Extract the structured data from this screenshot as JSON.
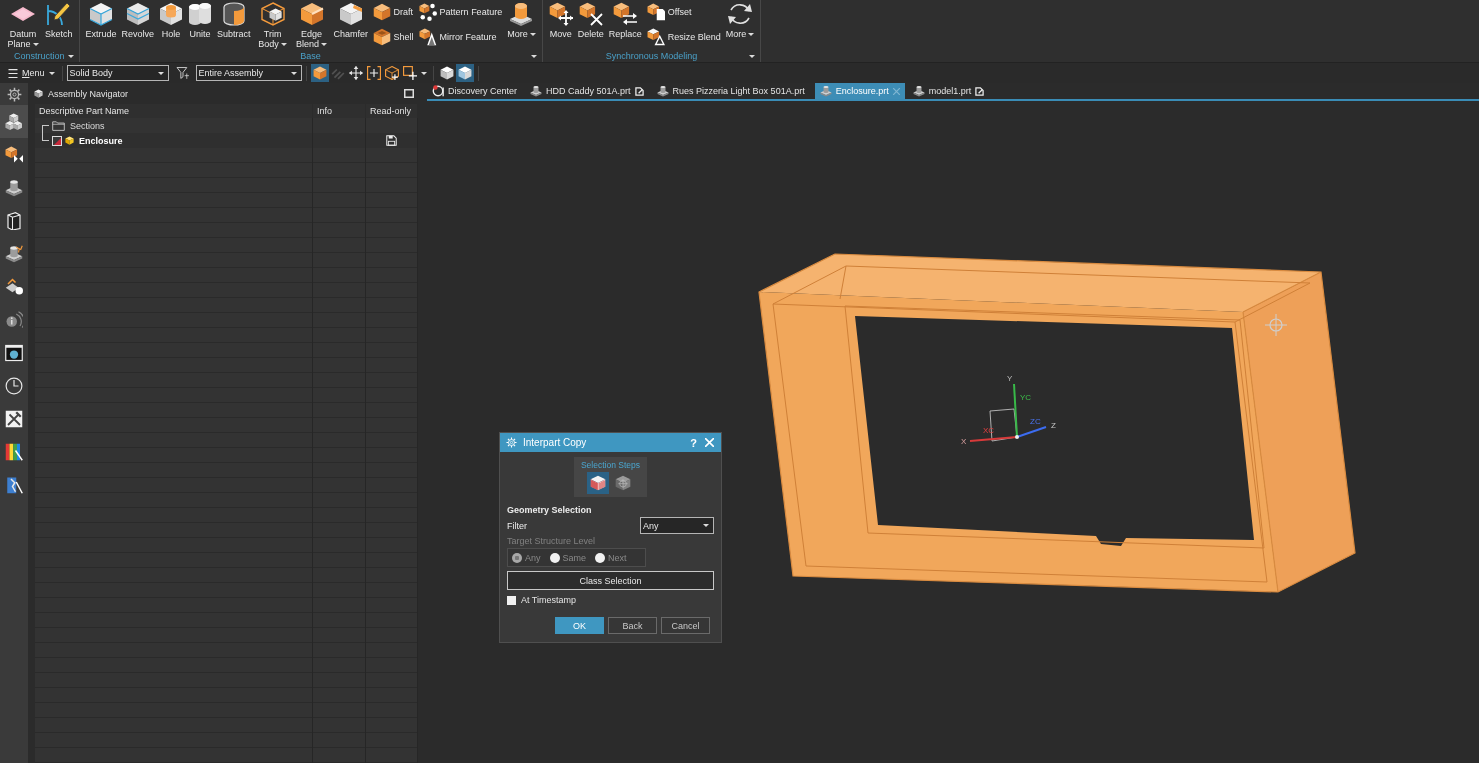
{
  "ribbon": {
    "groups": [
      {
        "label": "Construction",
        "launcher": true,
        "items": [
          {
            "kind": "large",
            "label": "Datum Plane",
            "dropdown": true
          },
          {
            "kind": "large",
            "label": "Sketch",
            "dropdown": false
          }
        ]
      },
      {
        "label": "Base",
        "launcher": true,
        "items": [
          {
            "kind": "large",
            "label": "Extrude",
            "dropdown": false
          },
          {
            "kind": "large",
            "label": "Revolve",
            "dropdown": false
          },
          {
            "kind": "large",
            "label": "Hole",
            "dropdown": false
          },
          {
            "kind": "large",
            "label": "Unite",
            "dropdown": false
          },
          {
            "kind": "large",
            "label": "Subtract",
            "dropdown": false
          },
          {
            "kind": "large",
            "label": "Trim Body",
            "dropdown": true
          },
          {
            "kind": "large",
            "label": "Edge Blend",
            "dropdown": true
          },
          {
            "kind": "large",
            "label": "Chamfer",
            "dropdown": false
          },
          {
            "kind": "stack",
            "items": [
              {
                "label": "Draft"
              },
              {
                "label": "Shell"
              }
            ]
          },
          {
            "kind": "stack",
            "items": [
              {
                "label": "Pattern Feature"
              },
              {
                "label": "Mirror Feature"
              }
            ]
          },
          {
            "kind": "large",
            "label": "More",
            "dropdown": true
          }
        ]
      },
      {
        "label": "Synchronous Modeling",
        "launcher": true,
        "items": [
          {
            "kind": "large",
            "label": "Move",
            "dropdown": false
          },
          {
            "kind": "large",
            "label": "Delete",
            "dropdown": false
          },
          {
            "kind": "large",
            "label": "Replace",
            "dropdown": false
          },
          {
            "kind": "stack",
            "items": [
              {
                "label": "Offset"
              },
              {
                "label": "Resize Blend"
              }
            ]
          },
          {
            "kind": "large",
            "label": "More",
            "dropdown": true
          }
        ]
      }
    ]
  },
  "toolbar": {
    "menu": "Menu",
    "type_filter": "Solid Body",
    "scope": "Entire Assembly",
    "tools": [
      {
        "on": true,
        "disabled": false
      },
      {
        "on": false,
        "disabled": true
      },
      {
        "on": false,
        "disabled": false
      },
      {
        "on": false,
        "disabled": false
      },
      {
        "on": false,
        "disabled": false
      },
      {
        "on": false,
        "disabled": false
      },
      {
        "on": false,
        "disabled": false
      },
      {
        "on": true,
        "disabled": false
      }
    ]
  },
  "sidebar": {
    "items": [
      {
        "selected": false
      },
      {
        "selected": true
      },
      {
        "selected": false
      },
      {
        "selected": false
      },
      {
        "selected": false
      },
      {
        "selected": false
      },
      {
        "selected": false
      },
      {
        "selected": false
      },
      {
        "selected": false
      },
      {
        "selected": false
      },
      {
        "selected": false
      },
      {
        "selected": false
      },
      {
        "selected": false
      }
    ]
  },
  "navigator": {
    "title": "Assembly Navigator",
    "columns": [
      "Descriptive Part Name",
      "Info",
      "Read-only"
    ],
    "rows": [
      {
        "kind": "folder",
        "name": "Sections"
      },
      {
        "kind": "part",
        "name": "Enclosure",
        "checked": true
      }
    ]
  },
  "tabs": [
    {
      "kind": "start",
      "label": "Discovery Center",
      "selected": false,
      "modified": false
    },
    {
      "kind": "part",
      "label": "HDD Caddy 501A.prt",
      "selected": false,
      "modified": true
    },
    {
      "kind": "part",
      "label": "Rues Pizzeria Light Box 501A.prt",
      "selected": false,
      "modified": false
    },
    {
      "kind": "part",
      "label": "Enclosure.prt",
      "selected": true,
      "modified": false
    },
    {
      "kind": "part",
      "label": "model1.prt",
      "selected": false,
      "modified": true
    }
  ],
  "viewport": {
    "triad": {
      "labels": [
        "X",
        "XC",
        "Y",
        "YC",
        "ZC",
        "Z"
      ]
    }
  },
  "dialog": {
    "title": "Interpart Copy",
    "help": "?",
    "steps_label": "Selection Steps",
    "steps": [
      {
        "selected": true
      },
      {
        "selected": false
      }
    ],
    "section": "Geometry Selection",
    "filter": {
      "label": "Filter",
      "value": "Any"
    },
    "structure": {
      "label": "Target Structure Level",
      "disabled": true,
      "options": [
        {
          "label": "Any",
          "selected": true
        },
        {
          "label": "Same",
          "selected": false
        },
        {
          "label": "Next",
          "selected": false
        }
      ]
    },
    "class_button": "Class Selection",
    "timestamp": {
      "label": "At Timestamp",
      "checked": false
    },
    "buttons": [
      {
        "kind": "primary",
        "label": "OK"
      },
      {
        "kind": "normal",
        "label": "Back"
      },
      {
        "kind": "normal",
        "label": "Cancel"
      }
    ]
  }
}
